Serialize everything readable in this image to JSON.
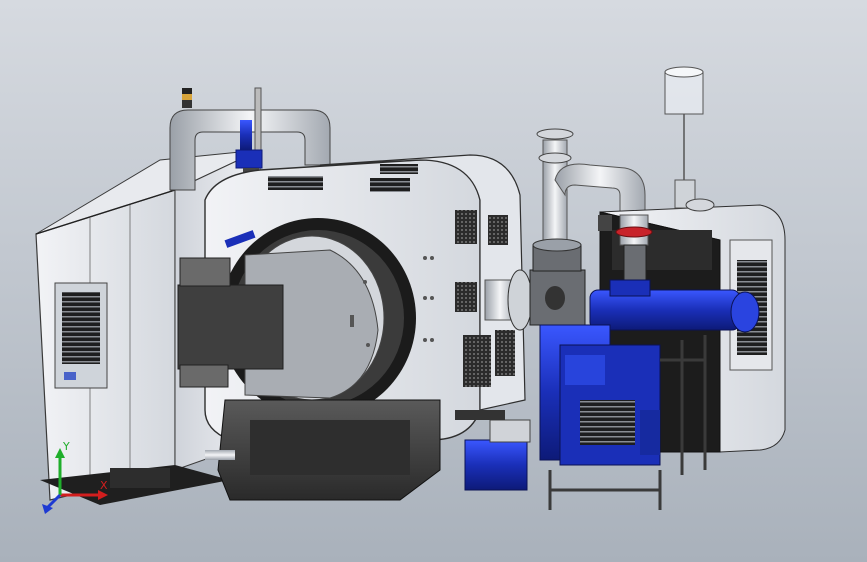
{
  "scene": {
    "background_top": "#d6dae0",
    "background_bottom": "#a9b1bb",
    "colors": {
      "panel_white": "#eef0f3",
      "panel_light": "#dfe2e8",
      "dark_steel": "#3c3c3c",
      "pump_blue": "#1a2fb8",
      "pipe_silver": "#cfd3d8"
    }
  },
  "triad": {
    "x_label": "X",
    "y_label": "Y",
    "x_color": "#d21e1e",
    "y_color": "#1fae2b",
    "z_color": "#1e3ad2"
  }
}
